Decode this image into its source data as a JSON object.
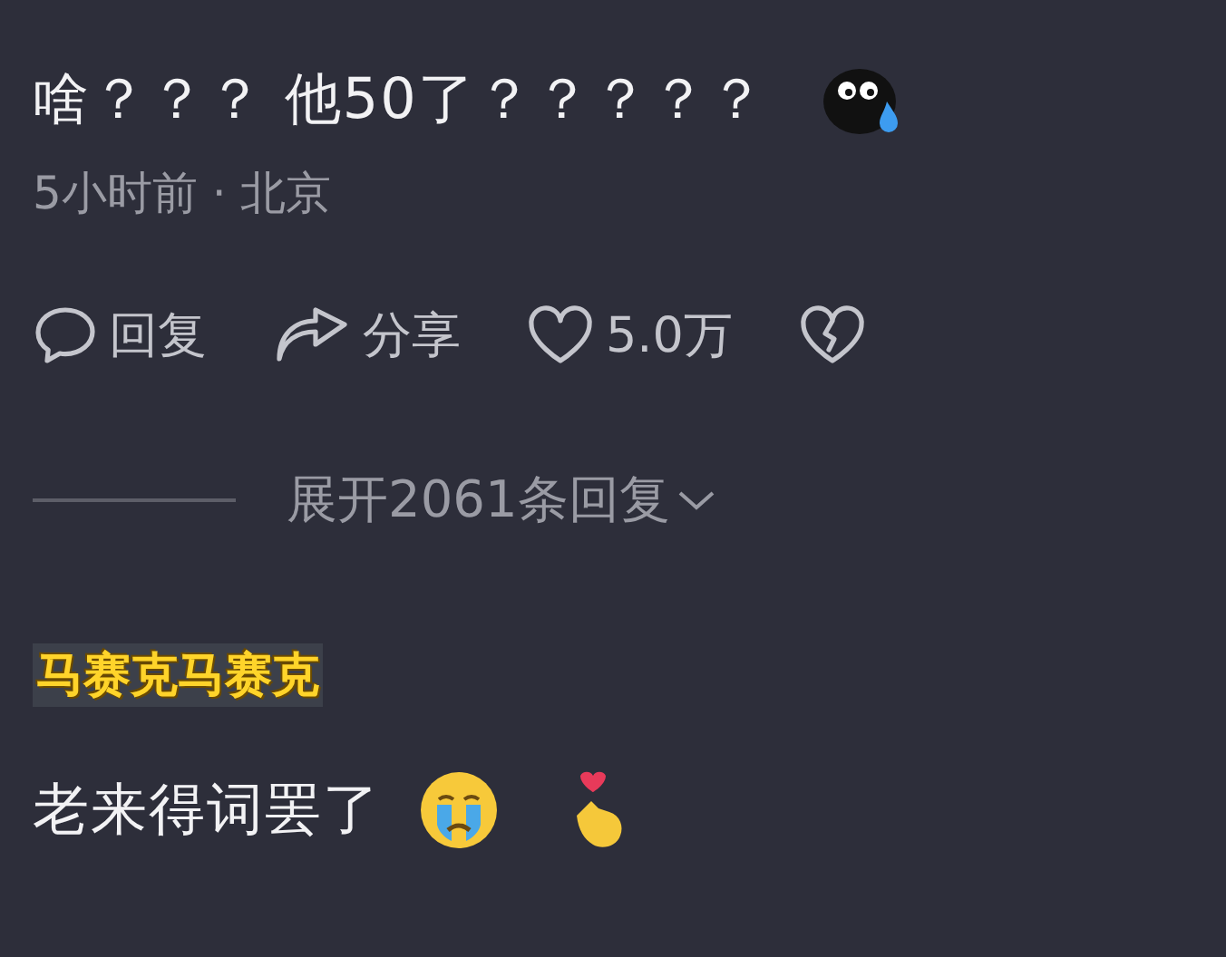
{
  "comment": {
    "text": "啥？？？ 他50了？？？？？",
    "meta": "5小时前 · 北京",
    "actions": [
      {
        "kind": "reply",
        "label": "回复"
      },
      {
        "kind": "share",
        "label": "分享"
      },
      {
        "kind": "like",
        "label": "5.0万"
      },
      {
        "kind": "dislike"
      }
    ],
    "expand": "展开2061条回复"
  },
  "next_comment": {
    "username": "马赛克马赛克",
    "text": "老来得词罢了"
  }
}
